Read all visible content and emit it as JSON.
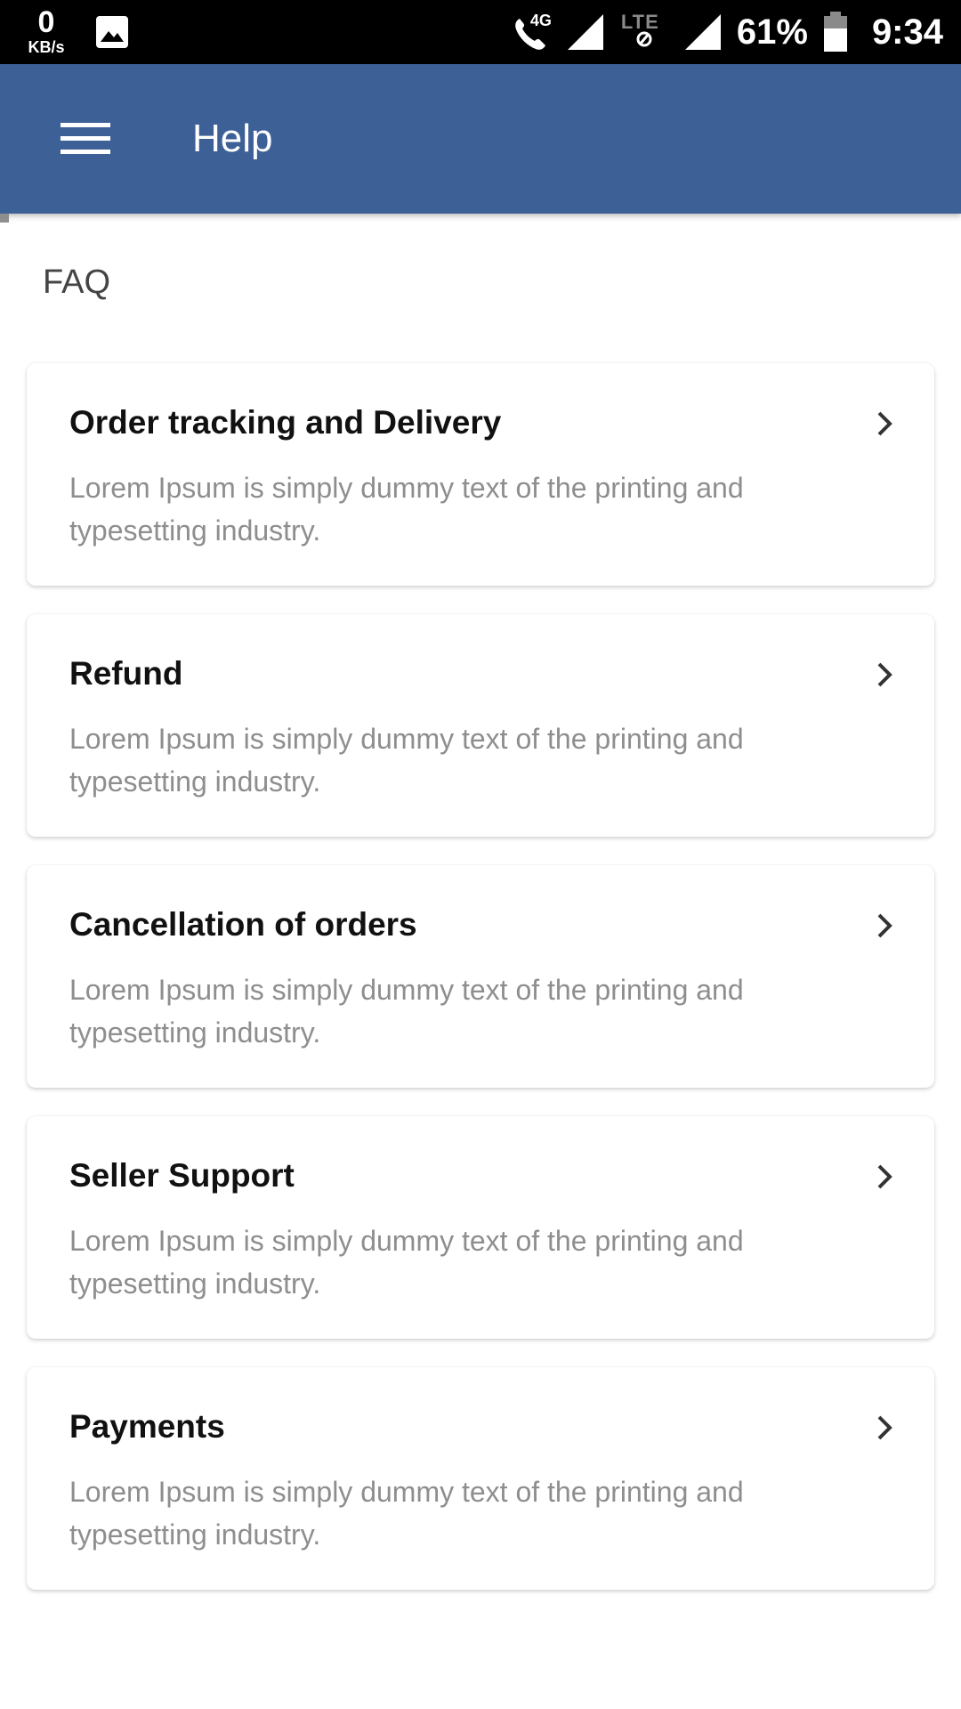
{
  "status_bar": {
    "net_speed_value": "0",
    "net_speed_unit": "KB/s",
    "call_tag": "4G",
    "lte_tag": "LTE",
    "battery_percent": "61%",
    "time": "9:34"
  },
  "app_bar": {
    "title": "Help",
    "color": "#3d6097"
  },
  "faq": {
    "heading": "FAQ",
    "items": [
      {
        "title": "Order tracking and Delivery",
        "description": "Lorem Ipsum is simply dummy text of the printing and typesetting industry."
      },
      {
        "title": "Refund",
        "description": "Lorem Ipsum is simply dummy text of the printing and typesetting industry."
      },
      {
        "title": "Cancellation of orders",
        "description": "Lorem Ipsum is simply dummy text of the printing and typesetting industry."
      },
      {
        "title": "Seller Support",
        "description": "Lorem Ipsum is simply dummy text of the printing and typesetting industry."
      },
      {
        "title": "Payments",
        "description": "Lorem Ipsum is simply dummy text of the printing and typesetting industry."
      }
    ]
  },
  "icons": {
    "menu": "hamburger-menu-icon",
    "chevron": "chevron-right-icon"
  }
}
